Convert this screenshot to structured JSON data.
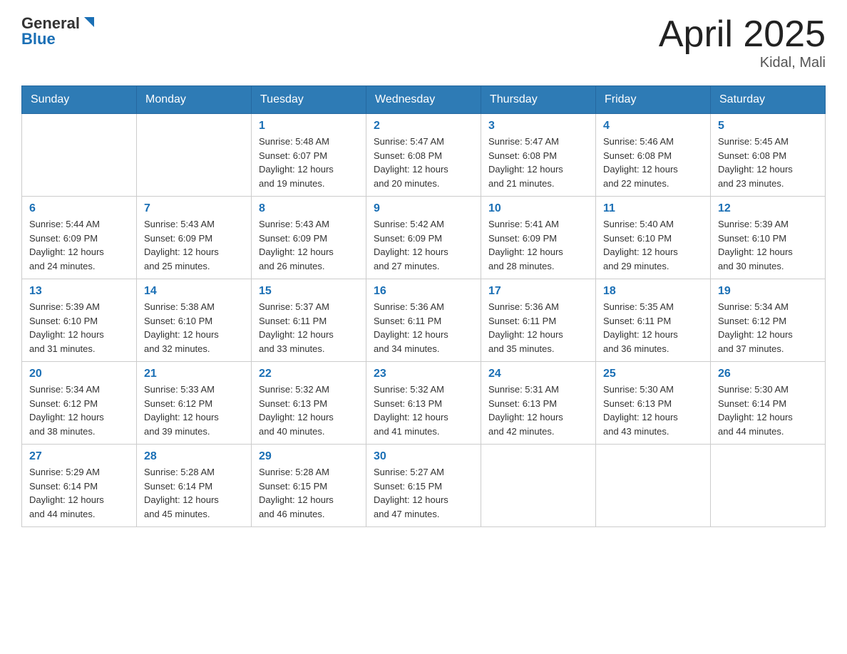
{
  "logo": {
    "general": "General",
    "blue": "Blue"
  },
  "header": {
    "month": "April 2025",
    "location": "Kidal, Mali"
  },
  "weekdays": [
    "Sunday",
    "Monday",
    "Tuesday",
    "Wednesday",
    "Thursday",
    "Friday",
    "Saturday"
  ],
  "weeks": [
    [
      {
        "day": "",
        "info": ""
      },
      {
        "day": "",
        "info": ""
      },
      {
        "day": "1",
        "info": "Sunrise: 5:48 AM\nSunset: 6:07 PM\nDaylight: 12 hours\nand 19 minutes."
      },
      {
        "day": "2",
        "info": "Sunrise: 5:47 AM\nSunset: 6:08 PM\nDaylight: 12 hours\nand 20 minutes."
      },
      {
        "day": "3",
        "info": "Sunrise: 5:47 AM\nSunset: 6:08 PM\nDaylight: 12 hours\nand 21 minutes."
      },
      {
        "day": "4",
        "info": "Sunrise: 5:46 AM\nSunset: 6:08 PM\nDaylight: 12 hours\nand 22 minutes."
      },
      {
        "day": "5",
        "info": "Sunrise: 5:45 AM\nSunset: 6:08 PM\nDaylight: 12 hours\nand 23 minutes."
      }
    ],
    [
      {
        "day": "6",
        "info": "Sunrise: 5:44 AM\nSunset: 6:09 PM\nDaylight: 12 hours\nand 24 minutes."
      },
      {
        "day": "7",
        "info": "Sunrise: 5:43 AM\nSunset: 6:09 PM\nDaylight: 12 hours\nand 25 minutes."
      },
      {
        "day": "8",
        "info": "Sunrise: 5:43 AM\nSunset: 6:09 PM\nDaylight: 12 hours\nand 26 minutes."
      },
      {
        "day": "9",
        "info": "Sunrise: 5:42 AM\nSunset: 6:09 PM\nDaylight: 12 hours\nand 27 minutes."
      },
      {
        "day": "10",
        "info": "Sunrise: 5:41 AM\nSunset: 6:09 PM\nDaylight: 12 hours\nand 28 minutes."
      },
      {
        "day": "11",
        "info": "Sunrise: 5:40 AM\nSunset: 6:10 PM\nDaylight: 12 hours\nand 29 minutes."
      },
      {
        "day": "12",
        "info": "Sunrise: 5:39 AM\nSunset: 6:10 PM\nDaylight: 12 hours\nand 30 minutes."
      }
    ],
    [
      {
        "day": "13",
        "info": "Sunrise: 5:39 AM\nSunset: 6:10 PM\nDaylight: 12 hours\nand 31 minutes."
      },
      {
        "day": "14",
        "info": "Sunrise: 5:38 AM\nSunset: 6:10 PM\nDaylight: 12 hours\nand 32 minutes."
      },
      {
        "day": "15",
        "info": "Sunrise: 5:37 AM\nSunset: 6:11 PM\nDaylight: 12 hours\nand 33 minutes."
      },
      {
        "day": "16",
        "info": "Sunrise: 5:36 AM\nSunset: 6:11 PM\nDaylight: 12 hours\nand 34 minutes."
      },
      {
        "day": "17",
        "info": "Sunrise: 5:36 AM\nSunset: 6:11 PM\nDaylight: 12 hours\nand 35 minutes."
      },
      {
        "day": "18",
        "info": "Sunrise: 5:35 AM\nSunset: 6:11 PM\nDaylight: 12 hours\nand 36 minutes."
      },
      {
        "day": "19",
        "info": "Sunrise: 5:34 AM\nSunset: 6:12 PM\nDaylight: 12 hours\nand 37 minutes."
      }
    ],
    [
      {
        "day": "20",
        "info": "Sunrise: 5:34 AM\nSunset: 6:12 PM\nDaylight: 12 hours\nand 38 minutes."
      },
      {
        "day": "21",
        "info": "Sunrise: 5:33 AM\nSunset: 6:12 PM\nDaylight: 12 hours\nand 39 minutes."
      },
      {
        "day": "22",
        "info": "Sunrise: 5:32 AM\nSunset: 6:13 PM\nDaylight: 12 hours\nand 40 minutes."
      },
      {
        "day": "23",
        "info": "Sunrise: 5:32 AM\nSunset: 6:13 PM\nDaylight: 12 hours\nand 41 minutes."
      },
      {
        "day": "24",
        "info": "Sunrise: 5:31 AM\nSunset: 6:13 PM\nDaylight: 12 hours\nand 42 minutes."
      },
      {
        "day": "25",
        "info": "Sunrise: 5:30 AM\nSunset: 6:13 PM\nDaylight: 12 hours\nand 43 minutes."
      },
      {
        "day": "26",
        "info": "Sunrise: 5:30 AM\nSunset: 6:14 PM\nDaylight: 12 hours\nand 44 minutes."
      }
    ],
    [
      {
        "day": "27",
        "info": "Sunrise: 5:29 AM\nSunset: 6:14 PM\nDaylight: 12 hours\nand 44 minutes."
      },
      {
        "day": "28",
        "info": "Sunrise: 5:28 AM\nSunset: 6:14 PM\nDaylight: 12 hours\nand 45 minutes."
      },
      {
        "day": "29",
        "info": "Sunrise: 5:28 AM\nSunset: 6:15 PM\nDaylight: 12 hours\nand 46 minutes."
      },
      {
        "day": "30",
        "info": "Sunrise: 5:27 AM\nSunset: 6:15 PM\nDaylight: 12 hours\nand 47 minutes."
      },
      {
        "day": "",
        "info": ""
      },
      {
        "day": "",
        "info": ""
      },
      {
        "day": "",
        "info": ""
      }
    ]
  ]
}
